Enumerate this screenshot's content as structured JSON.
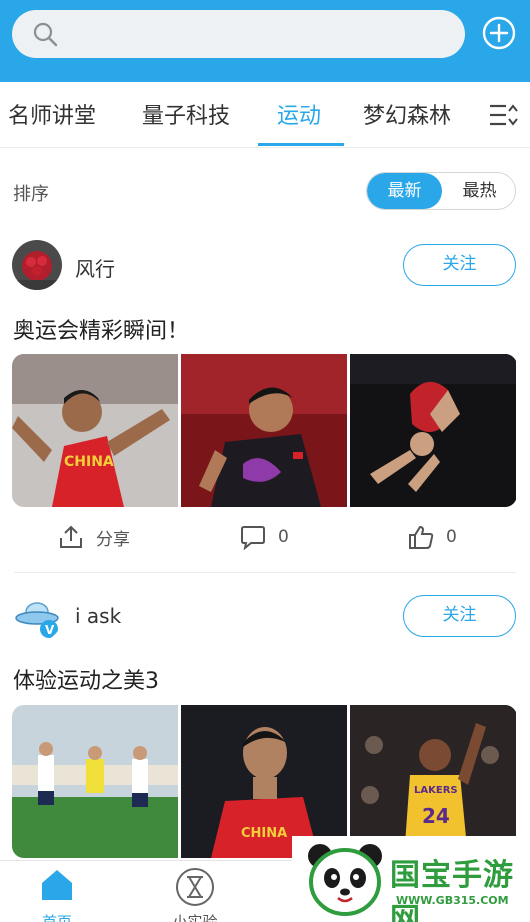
{
  "search": {
    "placeholder": "",
    "icon": "search-icon"
  },
  "header": {
    "add_icon": "add-circle-icon"
  },
  "tabs": [
    {
      "label": "名师讲堂",
      "active": false
    },
    {
      "label": "量子科技",
      "active": false
    },
    {
      "label": "运动",
      "active": true
    },
    {
      "label": "梦幻森林",
      "active": false
    }
  ],
  "sort": {
    "label": "排序",
    "options": [
      "最新",
      "最热"
    ],
    "selected": "最新"
  },
  "posts": [
    {
      "user": "风行",
      "follow_label": "关注",
      "title": "奥运会精彩瞬间！",
      "actions": {
        "share_label": "分享",
        "comments": "0",
        "likes": "0"
      }
    },
    {
      "user": "i ask",
      "follow_label": "关注",
      "title": "体验运动之美3"
    }
  ],
  "bottom_nav": [
    {
      "label": "首页",
      "active": true
    },
    {
      "label": "小实验",
      "active": false
    }
  ],
  "watermark": {
    "brand": "国宝手游网",
    "url": "WWW.GB315.COM"
  },
  "colors": {
    "accent": "#2aa7e8",
    "watermark": "#2f9c3e"
  }
}
